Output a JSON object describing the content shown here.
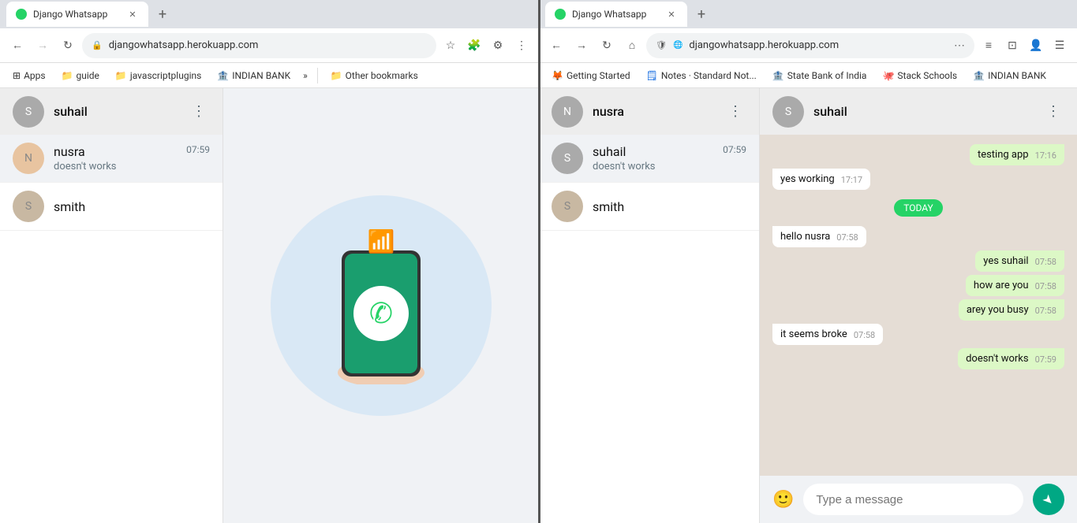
{
  "left_browser": {
    "tab": {
      "label": "Django Whatsapp",
      "favicon_color": "#25D366"
    },
    "address_bar": {
      "url": "djangowhatsapp.herokuapp.com",
      "back_disabled": false,
      "forward_disabled": false
    },
    "bookmarks": [
      {
        "id": "apps",
        "label": "Apps",
        "icon": "grid"
      },
      {
        "id": "guide",
        "label": "guide",
        "icon": "folder"
      },
      {
        "id": "javascriptplugins",
        "label": "javascriptplugins",
        "icon": "folder"
      },
      {
        "id": "indianbank",
        "label": "INDIAN BANK",
        "icon": "bookmark"
      },
      {
        "id": "more",
        "label": "»",
        "icon": null
      },
      {
        "id": "otherbookmarks",
        "label": "Other bookmarks",
        "icon": "folder"
      }
    ],
    "sidebar": {
      "username": "suhail",
      "menu_icon": "⋮",
      "contacts": [
        {
          "id": "nusra",
          "name": "nusra",
          "preview": "doesn't works",
          "time": "07:59",
          "avatar_color": "#e8c4a0"
        },
        {
          "id": "smith",
          "name": "smith",
          "preview": "",
          "time": "",
          "avatar_color": "#c8b8a2"
        }
      ]
    },
    "welcome": {
      "show": true
    }
  },
  "right_browser": {
    "tab": {
      "label": "Django Whatsapp",
      "favicon_color": "#25D366"
    },
    "address_bar": {
      "url": "djangowhatsapp.herokuapp.com",
      "back_disabled": false,
      "forward_disabled": false,
      "extensions_icon": "⋯"
    },
    "bookmarks": [
      {
        "id": "getting-started",
        "label": "Getting Started",
        "icon": "firefox"
      },
      {
        "id": "notes",
        "label": "Notes · Standard Not...",
        "icon": "notes"
      },
      {
        "id": "sbi",
        "label": "State Bank of India",
        "icon": "sbi"
      },
      {
        "id": "stack-schools",
        "label": "Stack Schools",
        "icon": "github"
      },
      {
        "id": "indian-bank",
        "label": "INDIAN BANK",
        "icon": "indianbank"
      }
    ],
    "sidebar": {
      "username": "nusra",
      "menu_icon": "⋮",
      "contacts": [
        {
          "id": "suhail",
          "name": "suhail",
          "preview": "doesn't works",
          "time": "07:59",
          "avatar_color": "#aaa"
        },
        {
          "id": "smith",
          "name": "smith",
          "preview": "",
          "time": "",
          "avatar_color": "#c8b8a2"
        }
      ]
    },
    "chat": {
      "header": {
        "name": "suhail",
        "avatar_color": "#aaa"
      },
      "messages": [
        {
          "id": "m1",
          "type": "sent",
          "text": "testing app",
          "time": "17:16"
        },
        {
          "id": "m2",
          "type": "received",
          "text": "yes working",
          "time": "17:17"
        },
        {
          "id": "divider",
          "type": "divider",
          "text": "TODAY"
        },
        {
          "id": "m3",
          "type": "received",
          "text": "hello nusra",
          "time": "07:58"
        },
        {
          "id": "m4",
          "type": "sent",
          "text": "yes suhail",
          "time": "07:58"
        },
        {
          "id": "m5",
          "type": "sent",
          "text": "how are you",
          "time": "07:58"
        },
        {
          "id": "m6",
          "type": "sent",
          "text": "arey you busy",
          "time": "07:58"
        },
        {
          "id": "m7",
          "type": "received",
          "text": "it seems broke",
          "time": "07:58"
        },
        {
          "id": "m8",
          "type": "sent",
          "text": "doesn't works",
          "time": "07:59"
        }
      ],
      "input": {
        "placeholder": "Type a message"
      }
    }
  },
  "icons": {
    "back": "←",
    "forward": "→",
    "reload": "↻",
    "home": "⌂",
    "shield": "🛡",
    "star": "★",
    "puzzle": "🧩",
    "settings": "⚙",
    "more": "⋮",
    "send": "➤",
    "emoji": "😊",
    "search": "🔍",
    "chat_new": "💬",
    "dots_three": "⋮"
  },
  "colors": {
    "whatsapp_green": "#25D366",
    "whatsapp_teal": "#00a884",
    "whatsapp_header": "#ededed",
    "whatsapp_bg": "#e5ddd5",
    "received_bubble": "#ffffff",
    "sent_bubble": "#dcf8c6",
    "today_badge": "#25D366",
    "browser_tab_bg": "#dee1e6"
  }
}
